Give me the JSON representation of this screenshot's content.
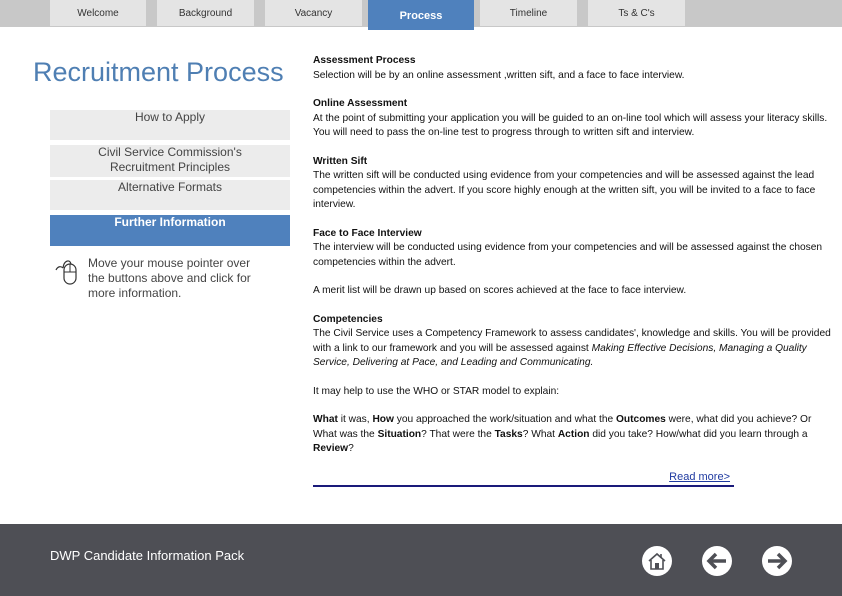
{
  "tabs": [
    {
      "label": "Welcome",
      "active": false
    },
    {
      "label": "Background",
      "active": false
    },
    {
      "label": "Vacancy",
      "active": false
    },
    {
      "label": "Process",
      "active": true
    },
    {
      "label": "Timeline",
      "active": false
    },
    {
      "label": "Ts & C's",
      "active": false
    }
  ],
  "page_title": "Recruitment Process",
  "sidebar": {
    "buttons": [
      {
        "label": "How to Apply",
        "active": false
      },
      {
        "label": "Civil Service Commission's Recruitment Principles",
        "active": false
      },
      {
        "label": "Alternative Formats",
        "active": false
      },
      {
        "label": "Further Information",
        "active": true
      }
    ],
    "hint": "Move your mouse pointer over the buttons above and click for more information.",
    "hint_icon": "mouse-icon"
  },
  "content": {
    "assessment": {
      "heading": "Assessment Process",
      "text": "Selection will be by an online assessment ,written sift, and a face to face interview."
    },
    "online": {
      "heading": "Online Assessment",
      "text": "At the point of submitting your application you will be guided to an on-line tool which will assess your literacy skills. You will need to pass the on-line test to progress through to written sift and interview."
    },
    "written": {
      "heading": "Written Sift",
      "text": "The written sift  will be conducted using evidence from your competencies  and will be assessed against the lead competencies within the advert.  If you  score highly enough at the written sift, you will be invited to a face to face interview."
    },
    "interview": {
      "heading": "Face to Face Interview",
      "text": "The interview  will be conducted using evidence from your competencies  and will be assessed against the chosen competencies within the advert."
    },
    "merit": "A merit list will be drawn up based on scores achieved at the face to face interview.",
    "competencies": {
      "heading": "Competencies",
      "text": "The Civil Service uses a Competency Framework to assess candidates', knowledge and skills. You will be provided with a link to our framework and you will be assessed against ",
      "italic": "Making Effective Decisions, Managing a Quality Service, Delivering at Pace, and Leading and Communicating."
    },
    "star_intro": "It may help to use the WHO or STAR model to explain:",
    "star": {
      "what_b": "What",
      "t1": " it was, ",
      "how_b": "How",
      "t2": " you approached the work/situation and what the ",
      "outcomes_b": "Outcomes",
      "t3": " were, what did you achieve?  Or What was the ",
      "situation_b": "Situation",
      "t4": "? That were the ",
      "tasks_b": "Tasks",
      "t5": "? What ",
      "action_b": "Action",
      "t6": " did you take? How/what did you learn through a ",
      "review_b": "Review",
      "t7": "?"
    },
    "read_more": "Read more>"
  },
  "footer": {
    "title": "DWP Candidate Information Pack",
    "icons": [
      "home-icon",
      "arrow-left-icon",
      "arrow-right-icon"
    ]
  }
}
